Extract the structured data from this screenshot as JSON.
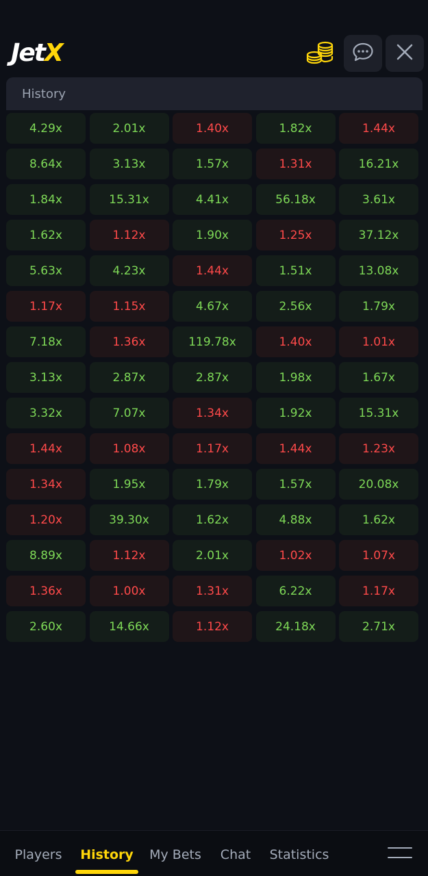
{
  "app": {
    "logo_main": "Jet",
    "logo_accent": "X"
  },
  "icons": {
    "coins": "coins-icon",
    "chat": "chat-bubble-icon",
    "close": "close-icon",
    "menu": "hamburger-menu-icon"
  },
  "colors": {
    "win": "#7ed957",
    "loss": "#ff4a4a",
    "accent": "#ffd60a"
  },
  "history": {
    "title": "History",
    "rows": [
      [
        {
          "v": "4.29x",
          "s": "win"
        },
        {
          "v": "2.01x",
          "s": "win"
        },
        {
          "v": "1.40x",
          "s": "loss"
        },
        {
          "v": "1.82x",
          "s": "win"
        },
        {
          "v": "1.44x",
          "s": "loss"
        }
      ],
      [
        {
          "v": "8.64x",
          "s": "win"
        },
        {
          "v": "3.13x",
          "s": "win"
        },
        {
          "v": "1.57x",
          "s": "win"
        },
        {
          "v": "1.31x",
          "s": "loss"
        },
        {
          "v": "16.21x",
          "s": "win"
        }
      ],
      [
        {
          "v": "1.84x",
          "s": "win"
        },
        {
          "v": "15.31x",
          "s": "win"
        },
        {
          "v": "4.41x",
          "s": "win"
        },
        {
          "v": "56.18x",
          "s": "win"
        },
        {
          "v": "3.61x",
          "s": "win"
        }
      ],
      [
        {
          "v": "1.62x",
          "s": "win"
        },
        {
          "v": "1.12x",
          "s": "loss"
        },
        {
          "v": "1.90x",
          "s": "win"
        },
        {
          "v": "1.25x",
          "s": "loss"
        },
        {
          "v": "37.12x",
          "s": "win"
        }
      ],
      [
        {
          "v": "5.63x",
          "s": "win"
        },
        {
          "v": "4.23x",
          "s": "win"
        },
        {
          "v": "1.44x",
          "s": "loss"
        },
        {
          "v": "1.51x",
          "s": "win"
        },
        {
          "v": "13.08x",
          "s": "win"
        }
      ],
      [
        {
          "v": "1.17x",
          "s": "loss"
        },
        {
          "v": "1.15x",
          "s": "loss"
        },
        {
          "v": "4.67x",
          "s": "win"
        },
        {
          "v": "2.56x",
          "s": "win"
        },
        {
          "v": "1.79x",
          "s": "win"
        }
      ],
      [
        {
          "v": "7.18x",
          "s": "win"
        },
        {
          "v": "1.36x",
          "s": "loss"
        },
        {
          "v": "119.78x",
          "s": "win"
        },
        {
          "v": "1.40x",
          "s": "loss"
        },
        {
          "v": "1.01x",
          "s": "loss"
        }
      ],
      [
        {
          "v": "3.13x",
          "s": "win"
        },
        {
          "v": "2.87x",
          "s": "win"
        },
        {
          "v": "2.87x",
          "s": "win"
        },
        {
          "v": "1.98x",
          "s": "win"
        },
        {
          "v": "1.67x",
          "s": "win"
        }
      ],
      [
        {
          "v": "3.32x",
          "s": "win"
        },
        {
          "v": "7.07x",
          "s": "win"
        },
        {
          "v": "1.34x",
          "s": "loss"
        },
        {
          "v": "1.92x",
          "s": "win"
        },
        {
          "v": "15.31x",
          "s": "win"
        }
      ],
      [
        {
          "v": "1.44x",
          "s": "loss"
        },
        {
          "v": "1.08x",
          "s": "loss"
        },
        {
          "v": "1.17x",
          "s": "loss"
        },
        {
          "v": "1.44x",
          "s": "loss"
        },
        {
          "v": "1.23x",
          "s": "loss"
        }
      ],
      [
        {
          "v": "1.34x",
          "s": "loss"
        },
        {
          "v": "1.95x",
          "s": "win"
        },
        {
          "v": "1.79x",
          "s": "win"
        },
        {
          "v": "1.57x",
          "s": "win"
        },
        {
          "v": "20.08x",
          "s": "win"
        }
      ],
      [
        {
          "v": "1.20x",
          "s": "loss"
        },
        {
          "v": "39.30x",
          "s": "win"
        },
        {
          "v": "1.62x",
          "s": "win"
        },
        {
          "v": "4.88x",
          "s": "win"
        },
        {
          "v": "1.62x",
          "s": "win"
        }
      ],
      [
        {
          "v": "8.89x",
          "s": "win"
        },
        {
          "v": "1.12x",
          "s": "loss"
        },
        {
          "v": "2.01x",
          "s": "win"
        },
        {
          "v": "1.02x",
          "s": "loss"
        },
        {
          "v": "1.07x",
          "s": "loss"
        }
      ],
      [
        {
          "v": "1.36x",
          "s": "loss"
        },
        {
          "v": "1.00x",
          "s": "loss"
        },
        {
          "v": "1.31x",
          "s": "loss"
        },
        {
          "v": "6.22x",
          "s": "win"
        },
        {
          "v": "1.17x",
          "s": "loss"
        }
      ],
      [
        {
          "v": "2.60x",
          "s": "win"
        },
        {
          "v": "14.66x",
          "s": "win"
        },
        {
          "v": "1.12x",
          "s": "loss"
        },
        {
          "v": "24.18x",
          "s": "win"
        },
        {
          "v": "2.71x",
          "s": "win"
        }
      ]
    ]
  },
  "nav": {
    "items": [
      {
        "label": "Players",
        "active": false
      },
      {
        "label": "History",
        "active": true
      },
      {
        "label": "My Bets",
        "active": false
      },
      {
        "label": "Chat",
        "active": false
      },
      {
        "label": "Statistics",
        "active": false
      }
    ]
  }
}
